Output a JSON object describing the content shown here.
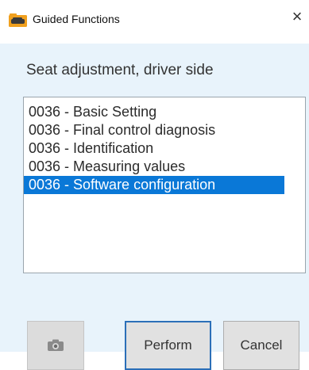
{
  "window": {
    "title": "Guided Functions",
    "app_icon": "folder-car-icon",
    "close_icon": "close-icon",
    "close_glyph": "×"
  },
  "dialog": {
    "heading": "Seat adjustment, driver side",
    "list": {
      "items": [
        "0036 - Basic Setting",
        "0036 - Final control diagnosis",
        "0036 - Identification",
        "0036 - Measuring values",
        "0036 - Software configuration"
      ],
      "selected_index": 4
    },
    "buttons": {
      "camera_icon": "camera-icon",
      "perform_label": "Perform",
      "cancel_label": "Cancel"
    }
  },
  "colors": {
    "accent": "#0a78d7",
    "panel_bg": "#e8f3fb"
  }
}
